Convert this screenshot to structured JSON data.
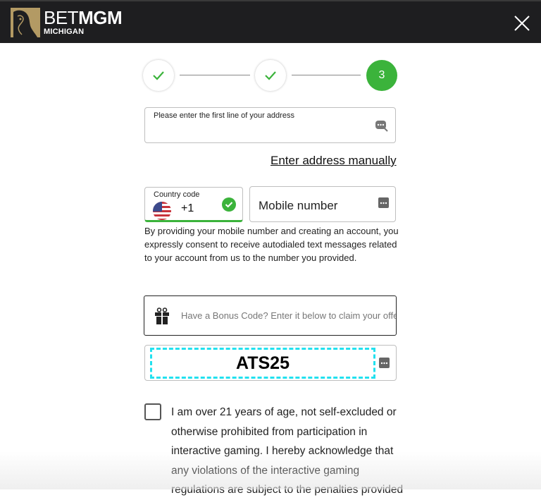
{
  "header": {
    "brand_thin": "BET",
    "brand_bold": "MGM",
    "region": "MICHIGAN",
    "close_icon": "close-icon"
  },
  "stepper": {
    "steps": [
      {
        "state": "complete",
        "icon": "check-icon"
      },
      {
        "state": "complete",
        "icon": "check-icon"
      },
      {
        "state": "active",
        "label": "3"
      }
    ],
    "accent_color": "#3bb33b"
  },
  "address": {
    "label": "Please enter the first line of your address",
    "value": "",
    "icon": "search-chat-icon",
    "manual_link": "Enter address manually"
  },
  "phone": {
    "country_label": "Country code",
    "country_flag": "us-flag-icon",
    "dial_code": "+1",
    "valid_icon": "check-circle-icon",
    "mobile_placeholder": "Mobile number",
    "mobile_icon": "dots-icon",
    "consent_text": "By providing your mobile number and creating an account, you expressly consent to receive autodialed text messages related to your account from us to the number you provided."
  },
  "bonus": {
    "icon": "gift-icon",
    "prompt": "Have a Bonus Code? Enter it below to claim your offer.",
    "code_value": "ATS25",
    "highlight_color": "#22e1ef"
  },
  "terms": {
    "checked": false,
    "text": "I am over 21 years of age, not self-excluded or otherwise prohibited from participation in interactive gaming. I hereby acknowledge that any violations of the interactive gaming regulations are subject to the penalties provided"
  }
}
